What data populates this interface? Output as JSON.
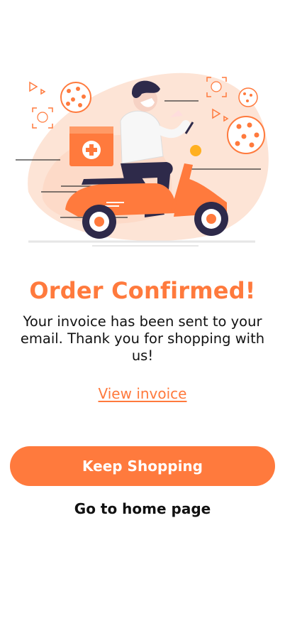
{
  "confirmation": {
    "title": "Order Confirmed!",
    "message": "Your invoice has been sent to your email. Thank you for shopping with us!",
    "view_invoice_label": "View invoice",
    "primary_button_label": "Keep Shopping",
    "secondary_link_label": "Go to home page"
  },
  "colors": {
    "accent": "#ff7a3d",
    "text": "#111111",
    "background": "#ffffff"
  },
  "illustration": {
    "icon": "delivery-scooter-icon"
  }
}
